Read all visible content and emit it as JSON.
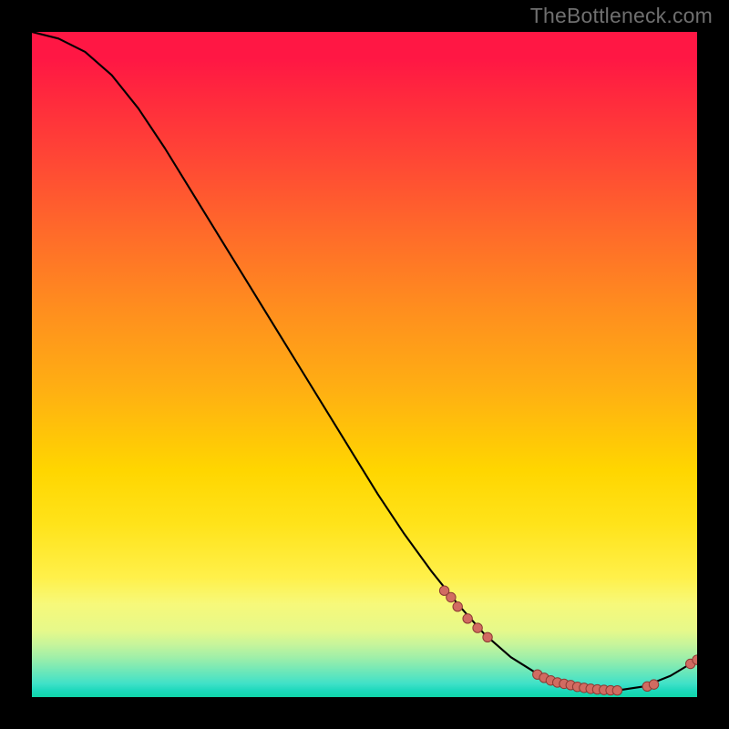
{
  "watermark": "TheBottleneck.com",
  "colors": {
    "curve": "#000000",
    "dot_fill": "#d16b61",
    "dot_stroke": "#8c3a34"
  },
  "chart_data": {
    "type": "line",
    "title": "",
    "xlabel": "",
    "ylabel": "",
    "xlim": [
      0,
      100
    ],
    "ylim": [
      0,
      100
    ],
    "grid": false,
    "legend": false,
    "x": [
      0,
      4,
      8,
      12,
      16,
      20,
      24,
      28,
      32,
      36,
      40,
      44,
      48,
      52,
      56,
      60,
      64,
      68,
      72,
      76,
      80,
      84,
      88,
      92,
      96,
      100
    ],
    "values": [
      100,
      99,
      97,
      93.5,
      88.5,
      82.5,
      76,
      69.5,
      63,
      56.5,
      50,
      43.5,
      37,
      30.5,
      24.5,
      19,
      14,
      9.5,
      6,
      3.5,
      2,
      1.2,
      1,
      1.6,
      3.2,
      5.6
    ],
    "markers": [
      {
        "x": 62,
        "y": 16.0
      },
      {
        "x": 63,
        "y": 15.0
      },
      {
        "x": 64,
        "y": 13.6
      },
      {
        "x": 65.5,
        "y": 11.8
      },
      {
        "x": 67,
        "y": 10.4
      },
      {
        "x": 68.5,
        "y": 9.0
      },
      {
        "x": 76,
        "y": 3.4
      },
      {
        "x": 77,
        "y": 2.9
      },
      {
        "x": 78,
        "y": 2.5
      },
      {
        "x": 79,
        "y": 2.2
      },
      {
        "x": 80,
        "y": 2.0
      },
      {
        "x": 81,
        "y": 1.8
      },
      {
        "x": 82,
        "y": 1.55
      },
      {
        "x": 83,
        "y": 1.4
      },
      {
        "x": 84,
        "y": 1.25
      },
      {
        "x": 85,
        "y": 1.15
      },
      {
        "x": 86,
        "y": 1.08
      },
      {
        "x": 87,
        "y": 1.02
      },
      {
        "x": 88,
        "y": 1.0
      },
      {
        "x": 92.5,
        "y": 1.6
      },
      {
        "x": 93.5,
        "y": 1.9
      },
      {
        "x": 99,
        "y": 5.0
      },
      {
        "x": 100,
        "y": 5.6
      }
    ]
  }
}
